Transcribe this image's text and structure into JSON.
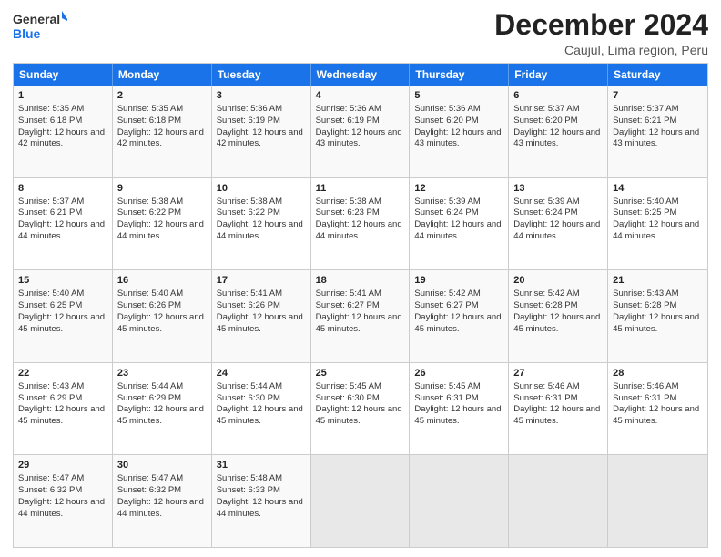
{
  "logo": {
    "line1": "General",
    "line2": "Blue"
  },
  "title": "December 2024",
  "subtitle": "Caujul, Lima region, Peru",
  "days": [
    "Sunday",
    "Monday",
    "Tuesday",
    "Wednesday",
    "Thursday",
    "Friday",
    "Saturday"
  ],
  "weeks": [
    [
      {
        "day": "1",
        "sunrise": "Sunrise: 5:35 AM",
        "sunset": "Sunset: 6:18 PM",
        "daylight": "Daylight: 12 hours and 42 minutes."
      },
      {
        "day": "2",
        "sunrise": "Sunrise: 5:35 AM",
        "sunset": "Sunset: 6:18 PM",
        "daylight": "Daylight: 12 hours and 42 minutes."
      },
      {
        "day": "3",
        "sunrise": "Sunrise: 5:36 AM",
        "sunset": "Sunset: 6:19 PM",
        "daylight": "Daylight: 12 hours and 42 minutes."
      },
      {
        "day": "4",
        "sunrise": "Sunrise: 5:36 AM",
        "sunset": "Sunset: 6:19 PM",
        "daylight": "Daylight: 12 hours and 43 minutes."
      },
      {
        "day": "5",
        "sunrise": "Sunrise: 5:36 AM",
        "sunset": "Sunset: 6:20 PM",
        "daylight": "Daylight: 12 hours and 43 minutes."
      },
      {
        "day": "6",
        "sunrise": "Sunrise: 5:37 AM",
        "sunset": "Sunset: 6:20 PM",
        "daylight": "Daylight: 12 hours and 43 minutes."
      },
      {
        "day": "7",
        "sunrise": "Sunrise: 5:37 AM",
        "sunset": "Sunset: 6:21 PM",
        "daylight": "Daylight: 12 hours and 43 minutes."
      }
    ],
    [
      {
        "day": "8",
        "sunrise": "Sunrise: 5:37 AM",
        "sunset": "Sunset: 6:21 PM",
        "daylight": "Daylight: 12 hours and 44 minutes."
      },
      {
        "day": "9",
        "sunrise": "Sunrise: 5:38 AM",
        "sunset": "Sunset: 6:22 PM",
        "daylight": "Daylight: 12 hours and 44 minutes."
      },
      {
        "day": "10",
        "sunrise": "Sunrise: 5:38 AM",
        "sunset": "Sunset: 6:22 PM",
        "daylight": "Daylight: 12 hours and 44 minutes."
      },
      {
        "day": "11",
        "sunrise": "Sunrise: 5:38 AM",
        "sunset": "Sunset: 6:23 PM",
        "daylight": "Daylight: 12 hours and 44 minutes."
      },
      {
        "day": "12",
        "sunrise": "Sunrise: 5:39 AM",
        "sunset": "Sunset: 6:24 PM",
        "daylight": "Daylight: 12 hours and 44 minutes."
      },
      {
        "day": "13",
        "sunrise": "Sunrise: 5:39 AM",
        "sunset": "Sunset: 6:24 PM",
        "daylight": "Daylight: 12 hours and 44 minutes."
      },
      {
        "day": "14",
        "sunrise": "Sunrise: 5:40 AM",
        "sunset": "Sunset: 6:25 PM",
        "daylight": "Daylight: 12 hours and 44 minutes."
      }
    ],
    [
      {
        "day": "15",
        "sunrise": "Sunrise: 5:40 AM",
        "sunset": "Sunset: 6:25 PM",
        "daylight": "Daylight: 12 hours and 45 minutes."
      },
      {
        "day": "16",
        "sunrise": "Sunrise: 5:40 AM",
        "sunset": "Sunset: 6:26 PM",
        "daylight": "Daylight: 12 hours and 45 minutes."
      },
      {
        "day": "17",
        "sunrise": "Sunrise: 5:41 AM",
        "sunset": "Sunset: 6:26 PM",
        "daylight": "Daylight: 12 hours and 45 minutes."
      },
      {
        "day": "18",
        "sunrise": "Sunrise: 5:41 AM",
        "sunset": "Sunset: 6:27 PM",
        "daylight": "Daylight: 12 hours and 45 minutes."
      },
      {
        "day": "19",
        "sunrise": "Sunrise: 5:42 AM",
        "sunset": "Sunset: 6:27 PM",
        "daylight": "Daylight: 12 hours and 45 minutes."
      },
      {
        "day": "20",
        "sunrise": "Sunrise: 5:42 AM",
        "sunset": "Sunset: 6:28 PM",
        "daylight": "Daylight: 12 hours and 45 minutes."
      },
      {
        "day": "21",
        "sunrise": "Sunrise: 5:43 AM",
        "sunset": "Sunset: 6:28 PM",
        "daylight": "Daylight: 12 hours and 45 minutes."
      }
    ],
    [
      {
        "day": "22",
        "sunrise": "Sunrise: 5:43 AM",
        "sunset": "Sunset: 6:29 PM",
        "daylight": "Daylight: 12 hours and 45 minutes."
      },
      {
        "day": "23",
        "sunrise": "Sunrise: 5:44 AM",
        "sunset": "Sunset: 6:29 PM",
        "daylight": "Daylight: 12 hours and 45 minutes."
      },
      {
        "day": "24",
        "sunrise": "Sunrise: 5:44 AM",
        "sunset": "Sunset: 6:30 PM",
        "daylight": "Daylight: 12 hours and 45 minutes."
      },
      {
        "day": "25",
        "sunrise": "Sunrise: 5:45 AM",
        "sunset": "Sunset: 6:30 PM",
        "daylight": "Daylight: 12 hours and 45 minutes."
      },
      {
        "day": "26",
        "sunrise": "Sunrise: 5:45 AM",
        "sunset": "Sunset: 6:31 PM",
        "daylight": "Daylight: 12 hours and 45 minutes."
      },
      {
        "day": "27",
        "sunrise": "Sunrise: 5:46 AM",
        "sunset": "Sunset: 6:31 PM",
        "daylight": "Daylight: 12 hours and 45 minutes."
      },
      {
        "day": "28",
        "sunrise": "Sunrise: 5:46 AM",
        "sunset": "Sunset: 6:31 PM",
        "daylight": "Daylight: 12 hours and 45 minutes."
      }
    ],
    [
      {
        "day": "29",
        "sunrise": "Sunrise: 5:47 AM",
        "sunset": "Sunset: 6:32 PM",
        "daylight": "Daylight: 12 hours and 44 minutes."
      },
      {
        "day": "30",
        "sunrise": "Sunrise: 5:47 AM",
        "sunset": "Sunset: 6:32 PM",
        "daylight": "Daylight: 12 hours and 44 minutes."
      },
      {
        "day": "31",
        "sunrise": "Sunrise: 5:48 AM",
        "sunset": "Sunset: 6:33 PM",
        "daylight": "Daylight: 12 hours and 44 minutes."
      },
      {
        "day": "",
        "sunrise": "",
        "sunset": "",
        "daylight": ""
      },
      {
        "day": "",
        "sunrise": "",
        "sunset": "",
        "daylight": ""
      },
      {
        "day": "",
        "sunrise": "",
        "sunset": "",
        "daylight": ""
      },
      {
        "day": "",
        "sunrise": "",
        "sunset": "",
        "daylight": ""
      }
    ]
  ]
}
